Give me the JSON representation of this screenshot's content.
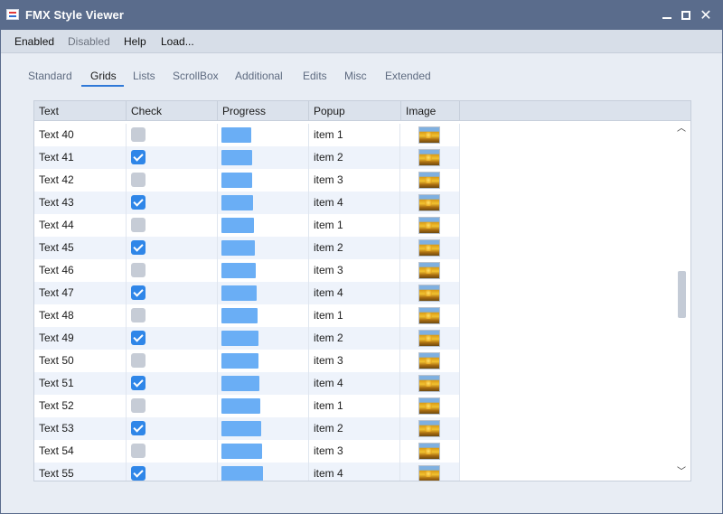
{
  "window": {
    "title": "FMX Style Viewer"
  },
  "menu": [
    {
      "label": "Enabled",
      "disabled": false
    },
    {
      "label": "Disabled",
      "disabled": true
    },
    {
      "label": "Help",
      "disabled": false
    },
    {
      "label": "Load...",
      "disabled": false
    }
  ],
  "tabs": [
    "Standard",
    "Grids",
    "Lists",
    "ScrollBox",
    "Additional",
    "Edits",
    "Misc",
    "Extended"
  ],
  "active_tab": "Grids",
  "grid": {
    "columns": [
      "Text",
      "Check",
      "Progress",
      "Popup",
      "Image"
    ],
    "rows": [
      {
        "text": "Text 40",
        "checked": false,
        "progress": 0.37,
        "popup": "item 1"
      },
      {
        "text": "Text 41",
        "checked": true,
        "progress": 0.38,
        "popup": "item 2"
      },
      {
        "text": "Text 42",
        "checked": false,
        "progress": 0.38,
        "popup": "item 3"
      },
      {
        "text": "Text 43",
        "checked": true,
        "progress": 0.39,
        "popup": "item 4"
      },
      {
        "text": "Text 44",
        "checked": false,
        "progress": 0.4,
        "popup": "item 1"
      },
      {
        "text": "Text 45",
        "checked": true,
        "progress": 0.41,
        "popup": "item 2"
      },
      {
        "text": "Text 46",
        "checked": false,
        "progress": 0.42,
        "popup": "item 3"
      },
      {
        "text": "Text 47",
        "checked": true,
        "progress": 0.43,
        "popup": "item 4"
      },
      {
        "text": "Text 48",
        "checked": false,
        "progress": 0.44,
        "popup": "item 1"
      },
      {
        "text": "Text 49",
        "checked": true,
        "progress": 0.45,
        "popup": "item 2"
      },
      {
        "text": "Text 50",
        "checked": false,
        "progress": 0.46,
        "popup": "item 3"
      },
      {
        "text": "Text 51",
        "checked": true,
        "progress": 0.47,
        "popup": "item 4"
      },
      {
        "text": "Text 52",
        "checked": false,
        "progress": 0.48,
        "popup": "item 1"
      },
      {
        "text": "Text 53",
        "checked": true,
        "progress": 0.49,
        "popup": "item 2"
      },
      {
        "text": "Text 54",
        "checked": false,
        "progress": 0.5,
        "popup": "item 3"
      },
      {
        "text": "Text 55",
        "checked": true,
        "progress": 0.51,
        "popup": "item 4"
      }
    ]
  },
  "colors": {
    "titlebar": "#5a6c8c",
    "accent": "#2f79d8",
    "checkbox_on": "#2f86e8",
    "progress": "#6aaef5"
  },
  "icons": {
    "app": "fmx-app-icon",
    "minimize": "minimize-icon",
    "maximize": "maximize-icon",
    "close": "close-icon"
  }
}
